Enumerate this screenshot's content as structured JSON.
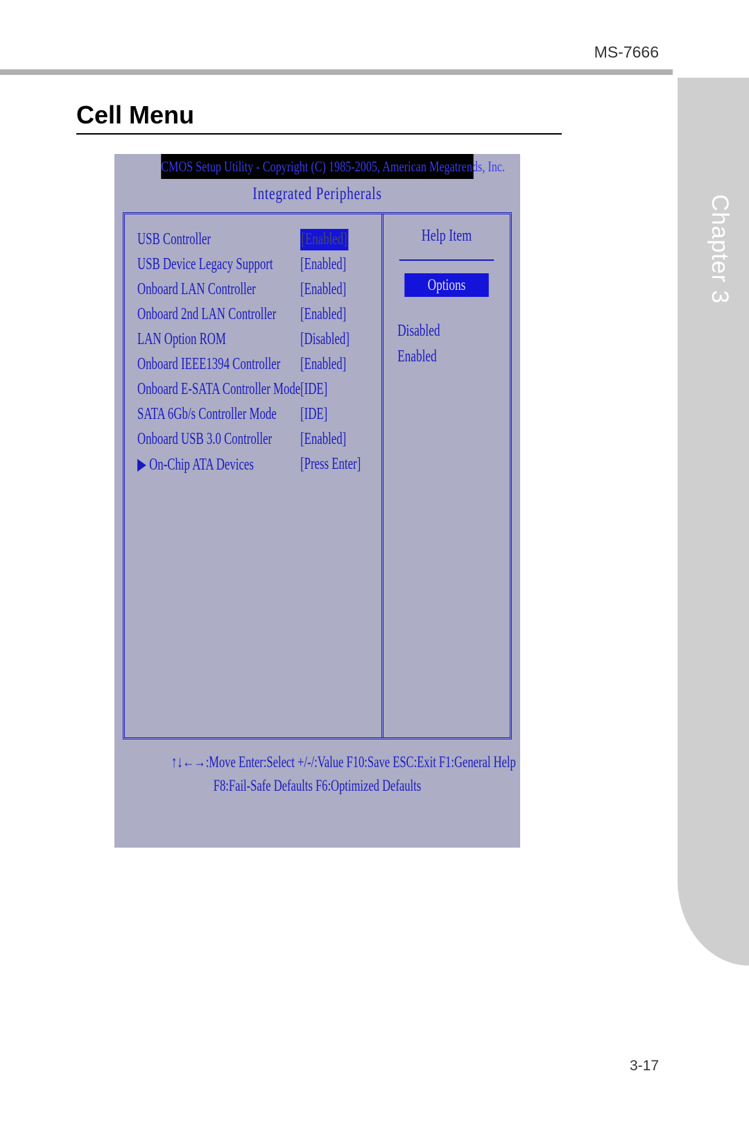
{
  "doc_id": "MS-7666",
  "chapter": "Chapter 3",
  "page_number": "3-17",
  "section_title": "Cell Menu",
  "bios": {
    "topbar": "CMOS Setup Utility - Copyright (C) 1985-2005, American Megatrends, Inc.",
    "subtitle": "Integrated Peripherals",
    "settings": [
      {
        "label": "USB Controller",
        "value": "[Enabled]",
        "selected": true
      },
      {
        "label": "USB Device Legacy Support",
        "value": "[Enabled]",
        "selected": false
      },
      {
        "label": "Onboard LAN Controller",
        "value": "[Enabled]",
        "selected": false
      },
      {
        "label": "Onboard 2nd LAN Controller",
        "value": "[Enabled]",
        "selected": false
      },
      {
        "label": "LAN Option ROM",
        "value": "[Disabled]",
        "selected": false
      },
      {
        "label": "Onboard IEEE1394 Controller",
        "value": "[Enabled]",
        "selected": false
      },
      {
        "label": "Onboard E-SATA Controller Mode",
        "value": "[IDE]",
        "selected": false
      },
      {
        "label": "SATA 6Gb/s Controller Mode",
        "value": "[IDE]",
        "selected": false
      },
      {
        "label": "Onboard USB 3.0 Controller",
        "value": "[Enabled]",
        "selected": false
      },
      {
        "label": "▶ On-Chip ATA Devices",
        "value": "[Press Enter]",
        "selected": false
      }
    ],
    "help_header": "Help Item",
    "options_title": "Options",
    "options": [
      "Disabled",
      "Enabled"
    ],
    "footer_line1": "↑↓←→:Move  Enter:Select  +/-/:Value  F10:Save  ESC:Exit  F1:General Help",
    "footer_line2": "F8:Fail-Safe Defaults    F6:Optimized Defaults"
  }
}
